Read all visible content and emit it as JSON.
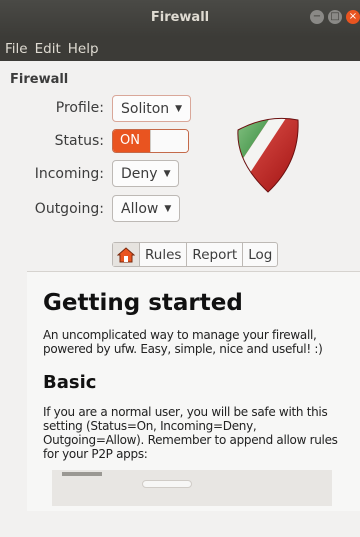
{
  "window": {
    "title": "Firewall",
    "buttons": [
      "minimize",
      "maximize",
      "close"
    ]
  },
  "menubar": {
    "items": [
      "File",
      "Edit",
      "Help"
    ]
  },
  "section": {
    "label": "Firewall"
  },
  "form": {
    "profile": {
      "label": "Profile:",
      "value": "Soliton"
    },
    "status": {
      "label": "Status:",
      "value": "ON"
    },
    "incoming": {
      "label": "Incoming:",
      "value": "Deny"
    },
    "outgoing": {
      "label": "Outgoing:",
      "value": "Allow"
    }
  },
  "tabs": {
    "home_icon": "home-icon",
    "items": [
      "Rules",
      "Report",
      "Log"
    ]
  },
  "doc": {
    "heading": "Getting started",
    "intro": "An uncomplicated way to manage your firewall, powered by ufw. Easy, simple, nice and useful! :)",
    "subheading": "Basic",
    "body": "If you are a normal user, you will be safe with this setting (Status=On, Incoming=Deny, Outgoing=Allow). Remember to append allow rules for your P2P apps:"
  },
  "colors": {
    "accent": "#e95420",
    "titlebar": "#3c3b37",
    "background": "#f2f1f0"
  }
}
